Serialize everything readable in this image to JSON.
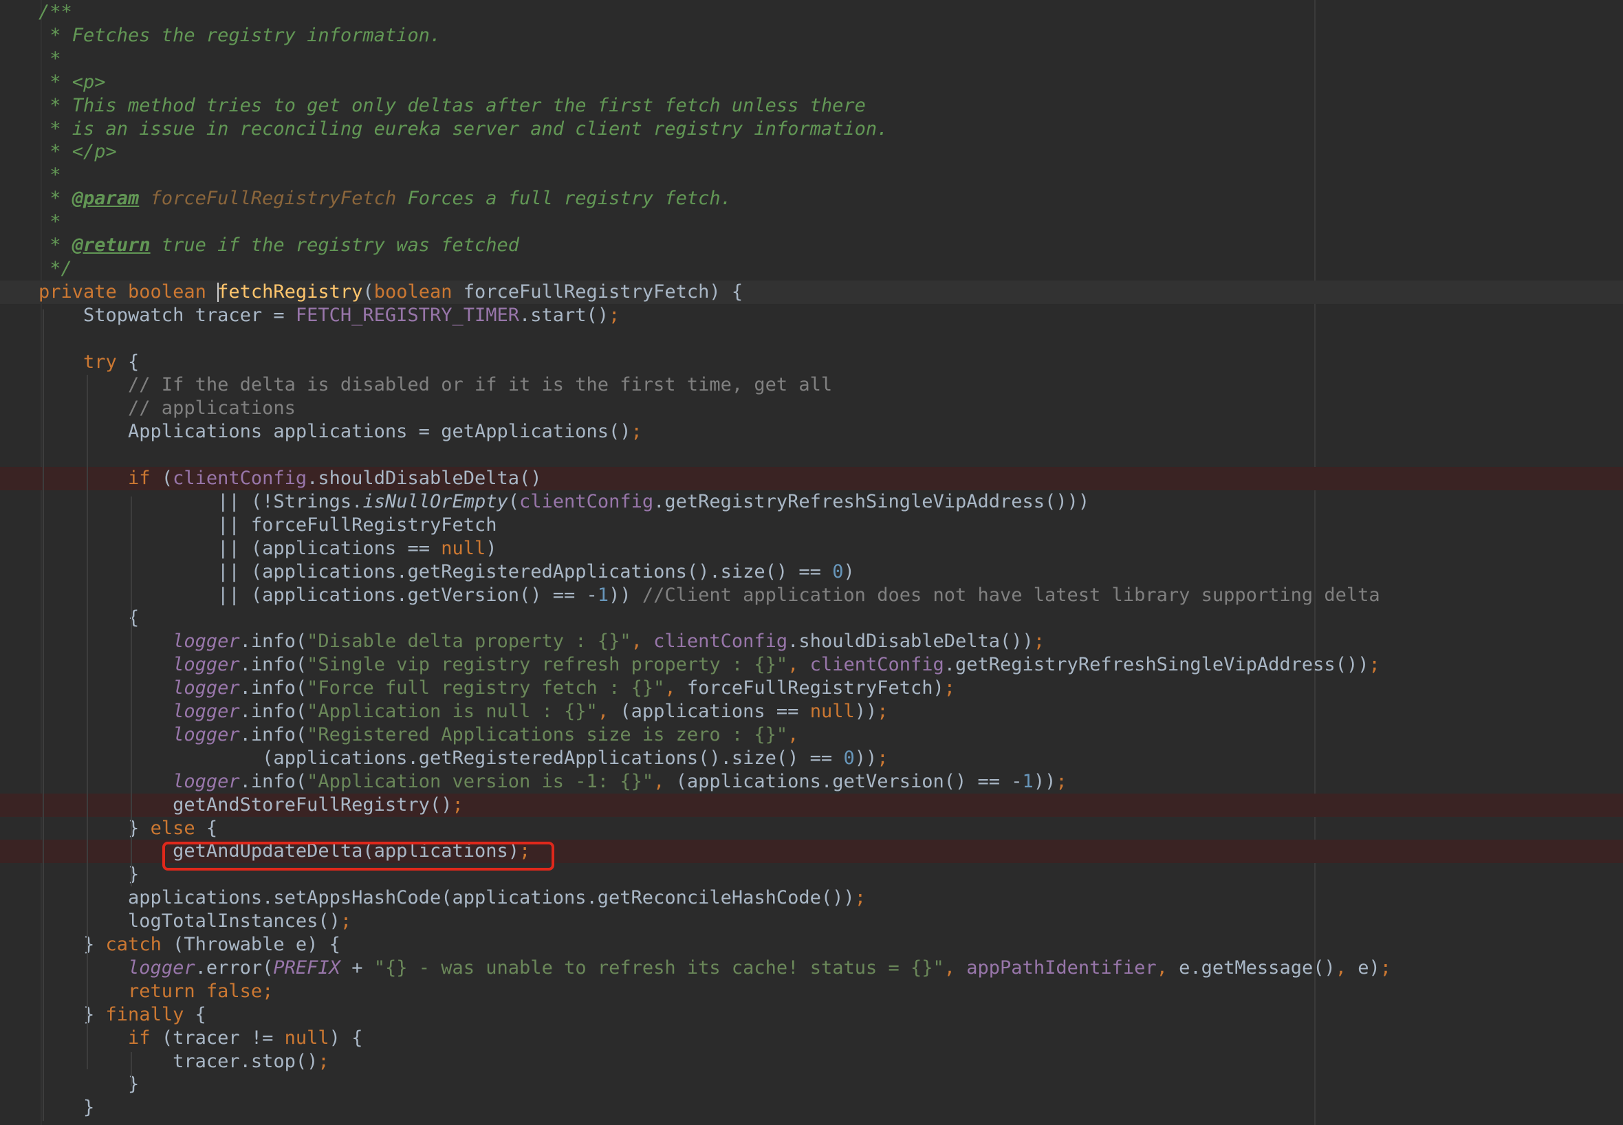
{
  "editor": {
    "colors": {
      "background": "#2b2b2b",
      "comment": "#629755",
      "keyword": "#cc7832",
      "method": "#ffc66d",
      "field": "#9876aa",
      "string": "#6a8759",
      "number": "#6897bb",
      "highlight_box": "#e0281b"
    },
    "lines": [
      {
        "tokens": [
          {
            "t": "/**",
            "c": "doc"
          }
        ]
      },
      {
        "tokens": [
          {
            "t": " * Fetches the registry information.",
            "c": "doc"
          }
        ]
      },
      {
        "tokens": [
          {
            "t": " *",
            "c": "doc"
          }
        ]
      },
      {
        "tokens": [
          {
            "t": " * <p>",
            "c": "doc"
          }
        ]
      },
      {
        "tokens": [
          {
            "t": " * This method tries to get only deltas after the first fetch unless there",
            "c": "doc"
          }
        ]
      },
      {
        "tokens": [
          {
            "t": " * is an issue in reconciling eureka server and client registry information.",
            "c": "doc"
          }
        ]
      },
      {
        "tokens": [
          {
            "t": " * </p>",
            "c": "doc"
          }
        ]
      },
      {
        "tokens": [
          {
            "t": " *",
            "c": "doc"
          }
        ]
      },
      {
        "tokens": [
          {
            "t": " * ",
            "c": "doc"
          },
          {
            "t": "@param",
            "c": "tag"
          },
          {
            "t": " ",
            "c": "doc"
          },
          {
            "t": "forceFullRegistryFetch",
            "c": "prm"
          },
          {
            "t": " Forces a full registry fetch.",
            "c": "doc"
          }
        ]
      },
      {
        "tokens": [
          {
            "t": " *",
            "c": "doc"
          }
        ]
      },
      {
        "tokens": [
          {
            "t": " * ",
            "c": "doc"
          },
          {
            "t": "@return",
            "c": "tag"
          },
          {
            "t": " true if the registry was fetched",
            "c": "doc"
          }
        ]
      },
      {
        "tokens": [
          {
            "t": " */",
            "c": "doc"
          }
        ]
      },
      {
        "bg": "cur",
        "tokens": [
          {
            "t": "private boolean ",
            "c": "kw"
          },
          {
            "caret": true
          },
          {
            "t": "fetchRegistry",
            "c": "fn"
          },
          {
            "t": "(",
            "c": "p1"
          },
          {
            "t": "boolean ",
            "c": "kw"
          },
          {
            "t": "forceFullRegistryFetch",
            "c": "pl"
          },
          {
            "t": ")",
            "c": "p1"
          },
          {
            "t": " {",
            "c": "p3"
          }
        ]
      },
      {
        "tokens": [
          {
            "t": "    Stopwatch tracer = ",
            "c": "pl"
          },
          {
            "t": "FETCH_REGISTRY_TIMER",
            "c": "fd"
          },
          {
            "t": ".start",
            "c": "pl"
          },
          {
            "t": "()",
            "c": "p1"
          },
          {
            "t": ";",
            "c": "kw"
          }
        ]
      },
      {
        "tokens": []
      },
      {
        "tokens": [
          {
            "t": "    try ",
            "c": "kw"
          },
          {
            "t": "{",
            "c": "p2"
          }
        ]
      },
      {
        "tokens": [
          {
            "t": "        // If the delta is disabled or if it is the first time, get all",
            "c": "cm"
          }
        ]
      },
      {
        "tokens": [
          {
            "t": "        // applications",
            "c": "cm"
          }
        ]
      },
      {
        "tokens": [
          {
            "t": "        Applications applications = getApplications",
            "c": "pl"
          },
          {
            "t": "()",
            "c": "p1"
          },
          {
            "t": ";",
            "c": "kw"
          }
        ]
      },
      {
        "tokens": []
      },
      {
        "bg": "bp",
        "tokens": [
          {
            "t": "        if ",
            "c": "kw"
          },
          {
            "t": "(",
            "c": "p1"
          },
          {
            "t": "clientConfig",
            "c": "fd"
          },
          {
            "t": ".shouldDisableDelta",
            "c": "pl"
          },
          {
            "t": "()",
            "c": "p3"
          }
        ]
      },
      {
        "tokens": [
          {
            "t": "                || ",
            "c": "pl"
          },
          {
            "t": "(",
            "c": "p3"
          },
          {
            "t": "!Strings.",
            "c": "pl"
          },
          {
            "t": "isNullOrEmpty",
            "c": "it"
          },
          {
            "t": "(",
            "c": "p2"
          },
          {
            "t": "clientConfig",
            "c": "fd"
          },
          {
            "t": ".getRegistryRefreshSingleVipAddress",
            "c": "pl"
          },
          {
            "t": "()",
            "c": "p2"
          },
          {
            "t": "))",
            "c": "p2"
          }
        ]
      },
      {
        "tokens": [
          {
            "t": "                || forceFullRegistryFetch",
            "c": "pl"
          }
        ]
      },
      {
        "tokens": [
          {
            "t": "                || ",
            "c": "pl"
          },
          {
            "t": "(",
            "c": "p3"
          },
          {
            "t": "applications == ",
            "c": "pl"
          },
          {
            "t": "null",
            "c": "kw"
          },
          {
            "t": ")",
            "c": "p3"
          }
        ]
      },
      {
        "tokens": [
          {
            "t": "                || ",
            "c": "pl"
          },
          {
            "t": "(",
            "c": "p3"
          },
          {
            "t": "applications.getRegisteredApplications",
            "c": "pl"
          },
          {
            "t": "()",
            "c": "p2"
          },
          {
            "t": ".size",
            "c": "pl"
          },
          {
            "t": "()",
            "c": "p2"
          },
          {
            "t": " == ",
            "c": "pl"
          },
          {
            "t": "0",
            "c": "nm"
          },
          {
            "t": ")",
            "c": "p3"
          }
        ]
      },
      {
        "tokens": [
          {
            "t": "                || ",
            "c": "pl"
          },
          {
            "t": "(",
            "c": "p3"
          },
          {
            "t": "applications.getVersion",
            "c": "pl"
          },
          {
            "t": "()",
            "c": "p2"
          },
          {
            "t": " == -",
            "c": "pl"
          },
          {
            "t": "1",
            "c": "nm"
          },
          {
            "t": "))",
            "c": "p1"
          },
          {
            "t": " //Client application does not have latest library supporting delta",
            "c": "cm"
          }
        ]
      },
      {
        "tokens": [
          {
            "t": "        {",
            "c": "p2"
          }
        ]
      },
      {
        "tokens": [
          {
            "t": "            ",
            "c": "pl"
          },
          {
            "t": "logger",
            "c": "fdi"
          },
          {
            "t": ".info",
            "c": "pl"
          },
          {
            "t": "(",
            "c": "p1"
          },
          {
            "t": "\"Disable delta property : {}\"",
            "c": "st"
          },
          {
            "t": ", ",
            "c": "kw"
          },
          {
            "t": "clientConfig",
            "c": "fd"
          },
          {
            "t": ".shouldDisableDelta",
            "c": "pl"
          },
          {
            "t": "()",
            "c": "p2"
          },
          {
            "t": ")",
            "c": "p1"
          },
          {
            "t": ";",
            "c": "kw"
          }
        ]
      },
      {
        "tokens": [
          {
            "t": "            ",
            "c": "pl"
          },
          {
            "t": "logger",
            "c": "fdi"
          },
          {
            "t": ".info",
            "c": "pl"
          },
          {
            "t": "(",
            "c": "p1"
          },
          {
            "t": "\"Single vip registry refresh property : {}\"",
            "c": "st"
          },
          {
            "t": ", ",
            "c": "kw"
          },
          {
            "t": "clientConfig",
            "c": "fd"
          },
          {
            "t": ".getRegistryRefreshSingleVipAddress",
            "c": "pl"
          },
          {
            "t": "()",
            "c": "p2"
          },
          {
            "t": ")",
            "c": "p1"
          },
          {
            "t": ";",
            "c": "kw"
          }
        ]
      },
      {
        "tokens": [
          {
            "t": "            ",
            "c": "pl"
          },
          {
            "t": "logger",
            "c": "fdi"
          },
          {
            "t": ".info",
            "c": "pl"
          },
          {
            "t": "(",
            "c": "p1"
          },
          {
            "t": "\"Force full registry fetch : {}\"",
            "c": "st"
          },
          {
            "t": ", ",
            "c": "kw"
          },
          {
            "t": "forceFullRegistryFetch",
            "c": "pl"
          },
          {
            "t": ")",
            "c": "p1"
          },
          {
            "t": ";",
            "c": "kw"
          }
        ]
      },
      {
        "tokens": [
          {
            "t": "            ",
            "c": "pl"
          },
          {
            "t": "logger",
            "c": "fdi"
          },
          {
            "t": ".info",
            "c": "pl"
          },
          {
            "t": "(",
            "c": "p1"
          },
          {
            "t": "\"Application is null : {}\"",
            "c": "st"
          },
          {
            "t": ", ",
            "c": "kw"
          },
          {
            "t": "(",
            "c": "p2"
          },
          {
            "t": "applications == ",
            "c": "pl"
          },
          {
            "t": "null",
            "c": "kw"
          },
          {
            "t": ")",
            "c": "p2"
          },
          {
            "t": ")",
            "c": "p1"
          },
          {
            "t": ";",
            "c": "kw"
          }
        ]
      },
      {
        "tokens": [
          {
            "t": "            ",
            "c": "pl"
          },
          {
            "t": "logger",
            "c": "fdi"
          },
          {
            "t": ".info",
            "c": "pl"
          },
          {
            "t": "(",
            "c": "p1"
          },
          {
            "t": "\"Registered Applications size is zero : {}\"",
            "c": "st"
          },
          {
            "t": ",",
            "c": "kw"
          }
        ]
      },
      {
        "tokens": [
          {
            "t": "                    ",
            "c": "pl"
          },
          {
            "t": "(",
            "c": "p2"
          },
          {
            "t": "applications.getRegisteredApplications",
            "c": "pl"
          },
          {
            "t": "()",
            "c": "p3"
          },
          {
            "t": ".size",
            "c": "pl"
          },
          {
            "t": "()",
            "c": "p3"
          },
          {
            "t": " == ",
            "c": "pl"
          },
          {
            "t": "0",
            "c": "nm"
          },
          {
            "t": ")",
            "c": "p2"
          },
          {
            "t": ")",
            "c": "p1"
          },
          {
            "t": ";",
            "c": "kw"
          }
        ]
      },
      {
        "tokens": [
          {
            "t": "            ",
            "c": "pl"
          },
          {
            "t": "logger",
            "c": "fdi"
          },
          {
            "t": ".info",
            "c": "pl"
          },
          {
            "t": "(",
            "c": "p1"
          },
          {
            "t": "\"Application version is -1: {}\"",
            "c": "st"
          },
          {
            "t": ", ",
            "c": "kw"
          },
          {
            "t": "(",
            "c": "p2"
          },
          {
            "t": "applications.getVersion",
            "c": "pl"
          },
          {
            "t": "()",
            "c": "p3"
          },
          {
            "t": " == -",
            "c": "pl"
          },
          {
            "t": "1",
            "c": "nm"
          },
          {
            "t": ")",
            "c": "p2"
          },
          {
            "t": ")",
            "c": "p1"
          },
          {
            "t": ";",
            "c": "kw"
          }
        ]
      },
      {
        "bg": "bp",
        "tokens": [
          {
            "t": "            getAndStoreFullRegistry",
            "c": "pl"
          },
          {
            "t": "()",
            "c": "p1"
          },
          {
            "t": ";",
            "c": "kw"
          }
        ]
      },
      {
        "tokens": [
          {
            "t": "        } ",
            "c": "p2"
          },
          {
            "t": "else ",
            "c": "kw"
          },
          {
            "t": "{",
            "c": "p2"
          }
        ]
      },
      {
        "bg": "bp",
        "tokens": [
          {
            "t": "            getAndUpdateDelta",
            "c": "pl"
          },
          {
            "t": "(",
            "c": "p1"
          },
          {
            "t": "applications",
            "c": "pl"
          },
          {
            "t": ")",
            "c": "p1"
          },
          {
            "t": ";",
            "c": "kw"
          }
        ]
      },
      {
        "tokens": [
          {
            "t": "        }",
            "c": "p2"
          }
        ]
      },
      {
        "tokens": [
          {
            "t": "        applications.setAppsHashCode",
            "c": "pl"
          },
          {
            "t": "(",
            "c": "p1"
          },
          {
            "t": "applications.getReconcileHashCode",
            "c": "pl"
          },
          {
            "t": "()",
            "c": "p3"
          },
          {
            "t": ")",
            "c": "p1"
          },
          {
            "t": ";",
            "c": "kw"
          }
        ]
      },
      {
        "tokens": [
          {
            "t": "        logTotalInstances",
            "c": "pl"
          },
          {
            "t": "()",
            "c": "p1"
          },
          {
            "t": ";",
            "c": "kw"
          }
        ]
      },
      {
        "tokens": [
          {
            "t": "    } ",
            "c": "p2"
          },
          {
            "t": "catch ",
            "c": "kw"
          },
          {
            "t": "(",
            "c": "p1"
          },
          {
            "t": "Throwable e",
            "c": "pl"
          },
          {
            "t": ")",
            "c": "p1"
          },
          {
            "t": " {",
            "c": "p2"
          }
        ]
      },
      {
        "tokens": [
          {
            "t": "        ",
            "c": "pl"
          },
          {
            "t": "logger",
            "c": "fdi"
          },
          {
            "t": ".error",
            "c": "pl"
          },
          {
            "t": "(",
            "c": "p1"
          },
          {
            "t": "PREFIX",
            "c": "fdi"
          },
          {
            "t": " + ",
            "c": "pl"
          },
          {
            "t": "\"{} - was unable to refresh its cache! status = {}\"",
            "c": "st"
          },
          {
            "t": ", ",
            "c": "kw"
          },
          {
            "t": "appPathIdentifier",
            "c": "fd"
          },
          {
            "t": ", ",
            "c": "kw"
          },
          {
            "t": "e.getMessage",
            "c": "pl"
          },
          {
            "t": "()",
            "c": "p2"
          },
          {
            "t": ", ",
            "c": "kw"
          },
          {
            "t": "e",
            "c": "pl"
          },
          {
            "t": ")",
            "c": "p1"
          },
          {
            "t": ";",
            "c": "kw"
          }
        ]
      },
      {
        "tokens": [
          {
            "t": "        return false;",
            "c": "kw"
          }
        ]
      },
      {
        "tokens": [
          {
            "t": "    } ",
            "c": "p2"
          },
          {
            "t": "finally ",
            "c": "kw"
          },
          {
            "t": "{",
            "c": "p2"
          }
        ]
      },
      {
        "tokens": [
          {
            "t": "        if ",
            "c": "kw"
          },
          {
            "t": "(",
            "c": "p1"
          },
          {
            "t": "tracer != ",
            "c": "pl"
          },
          {
            "t": "null",
            "c": "kw"
          },
          {
            "t": ")",
            "c": "p1"
          },
          {
            "t": " {",
            "c": "p2"
          }
        ]
      },
      {
        "tokens": [
          {
            "t": "            tracer.stop",
            "c": "pl"
          },
          {
            "t": "()",
            "c": "p1"
          },
          {
            "t": ";",
            "c": "kw"
          }
        ]
      },
      {
        "tokens": [
          {
            "t": "        }",
            "c": "p2"
          }
        ]
      },
      {
        "tokens": [
          {
            "t": "    }",
            "c": "p2"
          }
        ]
      }
    ]
  }
}
